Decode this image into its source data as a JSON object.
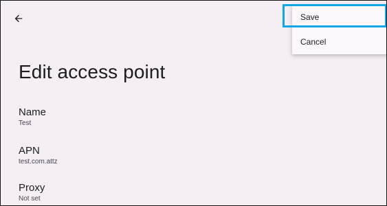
{
  "toolbar": {
    "back_icon": "arrow-back-icon"
  },
  "page": {
    "title": "Edit access point"
  },
  "preferences": [
    {
      "title": "Name",
      "summary": "Test"
    },
    {
      "title": "APN",
      "summary": "test.com.attz"
    },
    {
      "title": "Proxy",
      "summary": "Not set"
    }
  ],
  "menu": {
    "items": [
      {
        "label": "Save"
      },
      {
        "label": "Cancel"
      }
    ],
    "focused_item": "Save",
    "focus_color": "#13a6e5"
  }
}
